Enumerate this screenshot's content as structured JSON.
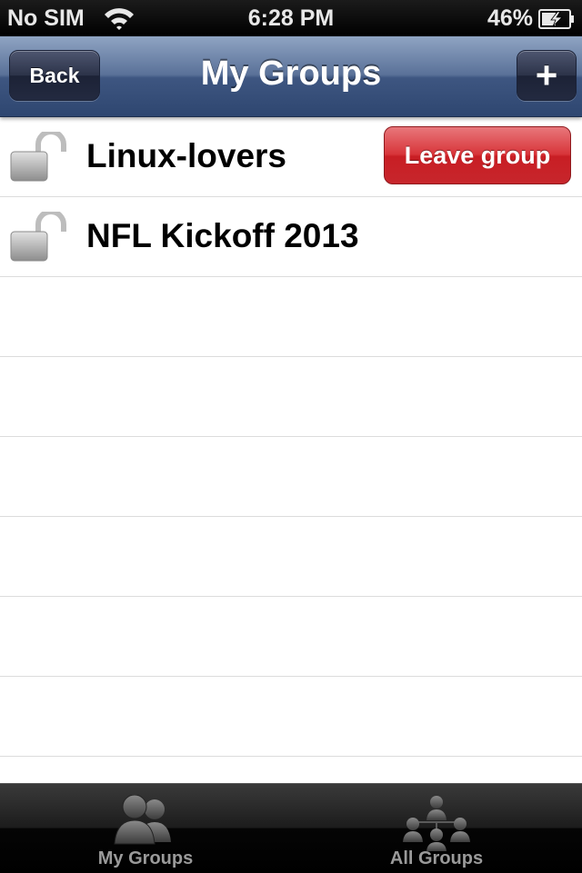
{
  "status_bar": {
    "carrier": "No SIM",
    "time": "6:28 PM",
    "battery": "46%"
  },
  "nav": {
    "back_label": "Back",
    "title": "My Groups",
    "add_label": "+"
  },
  "groups": [
    {
      "name": "Linux-lovers",
      "icon": "unlocked-padlock-icon",
      "action_label": "Leave group"
    },
    {
      "name": "NFL Kickoff 2013",
      "icon": "unlocked-padlock-icon"
    }
  ],
  "tabs": [
    {
      "label": "My Groups",
      "icon": "two-people-icon"
    },
    {
      "label": "All Groups",
      "icon": "people-network-icon"
    }
  ],
  "colors": {
    "nav_bar": "#4a6290",
    "leave_button": "#d22a30",
    "tab_bar": "#000000"
  }
}
